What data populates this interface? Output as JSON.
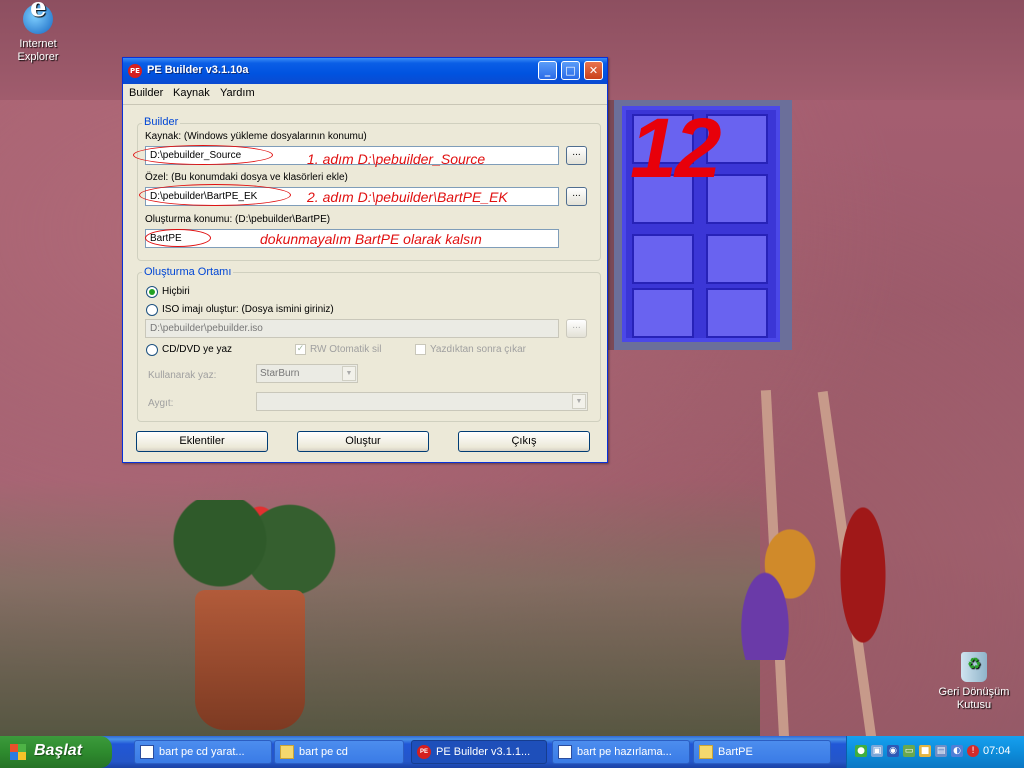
{
  "desktop": {
    "icons": [
      {
        "label_line1": "Internet",
        "label_line2": "Explorer"
      },
      {
        "label_line1": "Geri Dönüşüm",
        "label_line2": "Kutusu"
      }
    ],
    "overlay_number": "12"
  },
  "window": {
    "title": "PE Builder v3.1.10a",
    "icon_text": "PE",
    "menu": [
      "Builder",
      "Kaynak",
      "Yardım"
    ],
    "builder_group": {
      "label": "Builder",
      "source_label": "Kaynak: (Windows yükleme dosyalarının konumu)",
      "source_value": "D:\\pebuilder_Source",
      "custom_label": "Özel: (Bu konumdaki dosya ve klasörleri ekle)",
      "custom_value": "D:\\pebuilder\\BartPE_EK",
      "output_label": "Oluşturma konumu: (D:\\pebuilder\\BartPE)",
      "output_value": "BartPE",
      "browse": "..."
    },
    "media_group": {
      "label": "Oluşturma Ortamı",
      "option_none": "Hiçbiri",
      "option_iso": "ISO imajı oluştur: (Dosya ismini giriniz)",
      "iso_path": "D:\\pebuilder\\pebuilder.iso",
      "option_cd": "CD/DVD ye yaz",
      "rw_erase": "RW Otomatik sil",
      "eject": "Yazdıktan sonra çıkar",
      "burn_using_label": "Kullanarak yaz:",
      "burner_value": "StarBurn",
      "device_label": "Aygıt:",
      "device_value": "",
      "browse": "...",
      "selected_option": "none"
    },
    "buttons": {
      "plugins": "Eklentiler",
      "build": "Oluştur",
      "exit": "Çıkış"
    }
  },
  "annotations": {
    "step1": "1. adım D:\\pebuilder_Source",
    "step2": "2. adım D:\\pebuilder\\BartPE_EK",
    "step3": "dokunmayalım BartPE olarak kalsın"
  },
  "taskbar": {
    "start_label": "Başlat",
    "items": [
      {
        "label": "bart pe cd yarat...",
        "icon": "document-icon",
        "active": false
      },
      {
        "label": "bart pe cd",
        "icon": "folder-icon",
        "active": false
      },
      {
        "label": "PE Builder v3.1.1...",
        "icon": "pe-icon",
        "active": true
      },
      {
        "label": "bart pe hazırlama...",
        "icon": "document-icon",
        "active": false
      },
      {
        "label": "BartPE",
        "icon": "folder-icon",
        "active": false
      }
    ],
    "clock": "07:04"
  },
  "colors": {
    "annotation_red": "#e01010",
    "group_label_blue": "#0046d5",
    "xp_titlebar": "#0053e0",
    "start_green": "#2e8b2e"
  }
}
